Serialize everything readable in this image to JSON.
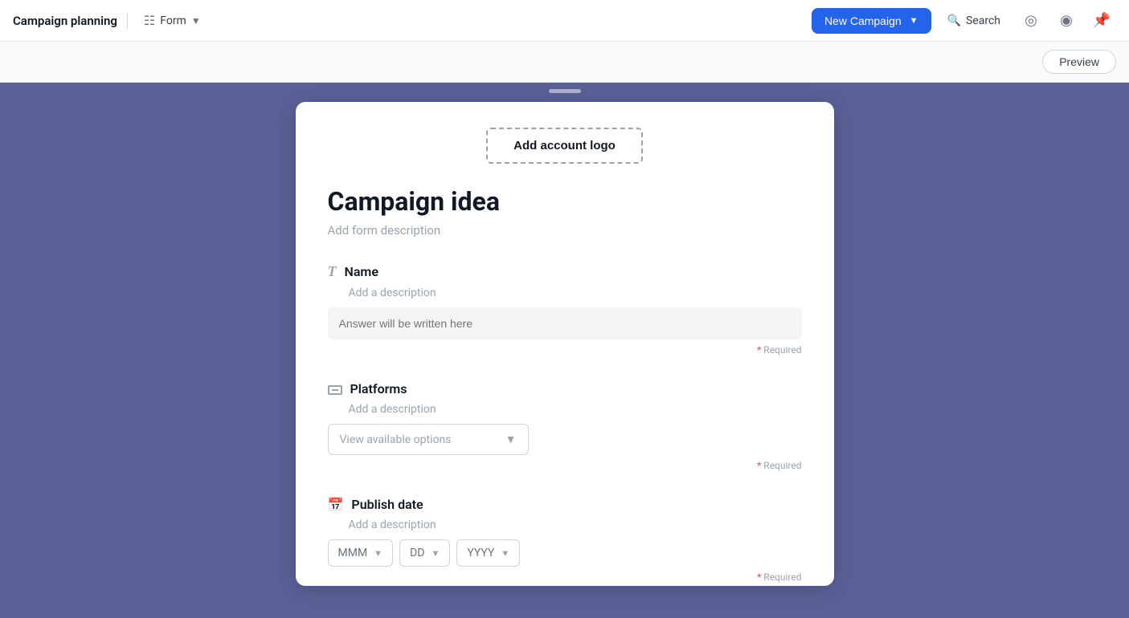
{
  "header": {
    "app_title": "Campaign planning",
    "form_label": "Form",
    "new_campaign_label": "New Campaign",
    "search_label": "Search"
  },
  "preview_bar": {
    "preview_label": "Preview"
  },
  "form": {
    "logo_button": "Add account logo",
    "title": "Campaign idea",
    "description": "Add form description",
    "fields": [
      {
        "id": "name",
        "icon_type": "text",
        "label": "Name",
        "description": "Add a description",
        "placeholder": "Answer will be written here",
        "type": "text",
        "required_label": "* Required"
      },
      {
        "id": "platforms",
        "icon_type": "dropdown",
        "label": "Platforms",
        "description": "Add a description",
        "placeholder": "View available options",
        "type": "dropdown",
        "required_label": "* Required"
      },
      {
        "id": "publish_date",
        "icon_type": "calendar",
        "label": "Publish date",
        "description": "Add a description",
        "type": "date",
        "date_parts": [
          "MMM",
          "DD",
          "YYYY"
        ],
        "required_label": "* Required"
      }
    ]
  }
}
